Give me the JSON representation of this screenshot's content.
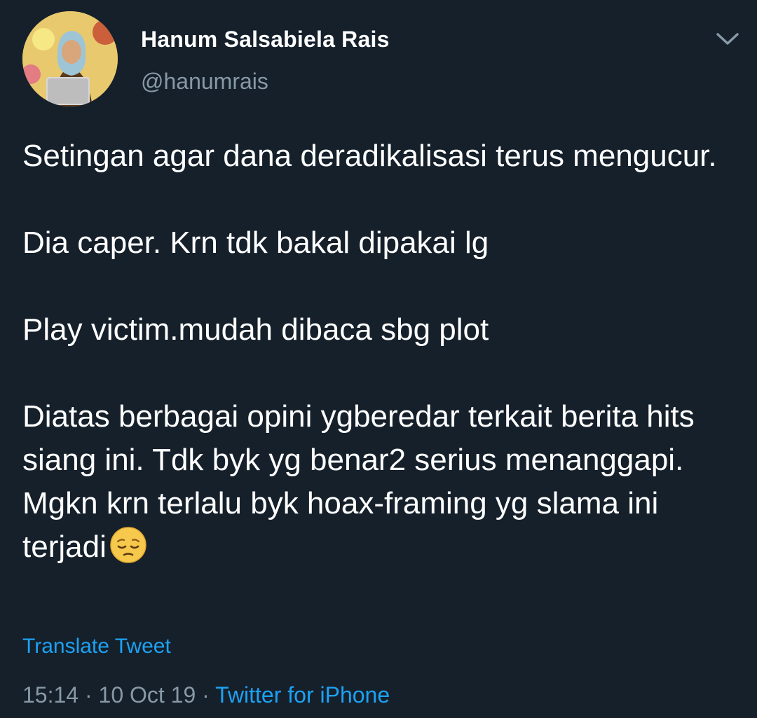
{
  "tweet": {
    "author_name": "Hanum Salsabiela Rais",
    "author_handle": "@hanumrais",
    "paragraphs": [
      "Setingan agar dana deradikalisasi terus mengucur.",
      "Dia caper. Krn tdk bakal dipakai lg",
      "Play victim.mudah dibaca sbg plot",
      "Diatas berbagai opini ygberedar terkait berita hits siang ini. Tdk byk yg benar2 serius menanggapi. Mgkn krn terlalu byk hoax-framing yg slama ini terjadi"
    ],
    "emoji": "pensive-face-emoji",
    "translate_label": "Translate Tweet",
    "time": "15:14",
    "separator": " · ",
    "date": "10 Oct 19",
    "source": "Twitter for iPhone"
  },
  "icons": {
    "menu": "chevron-down-icon"
  },
  "colors": {
    "background": "#15202b",
    "text_primary": "#ffffff",
    "text_secondary": "#8899a6",
    "link": "#1da1f2"
  }
}
